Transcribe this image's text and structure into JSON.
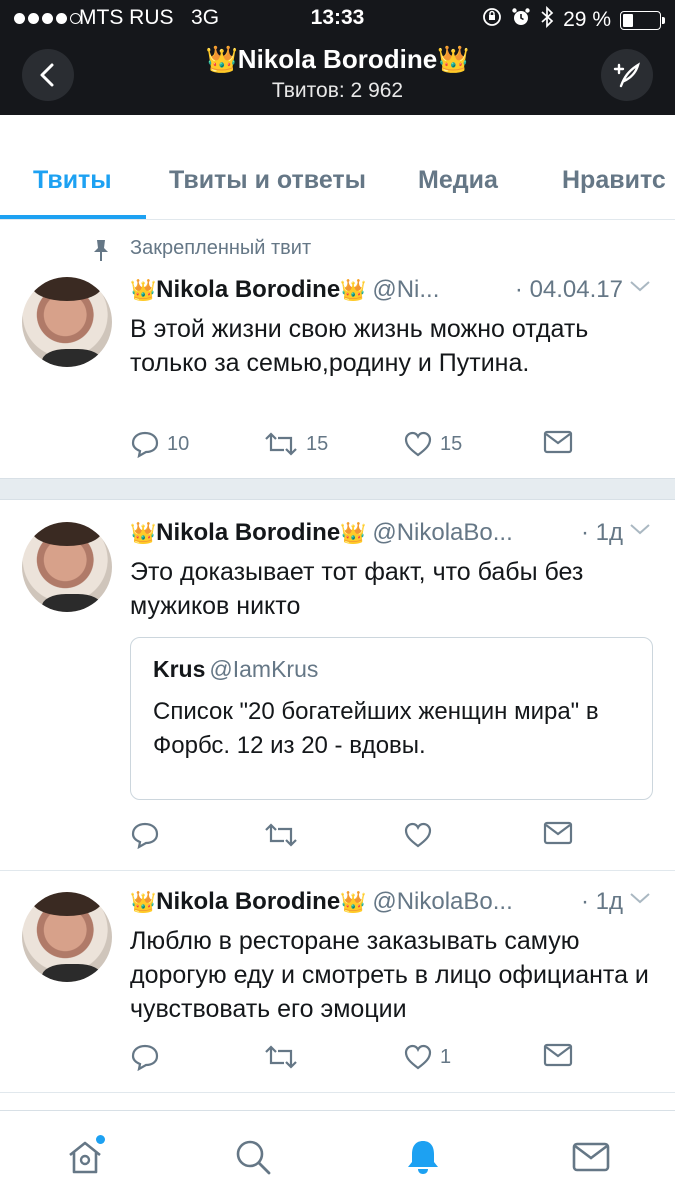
{
  "status_bar": {
    "carrier": "MTS RUS",
    "network": "3G",
    "time": "13:33",
    "battery": "29 %",
    "battery_level": 0.29,
    "signal_bars": 4
  },
  "header": {
    "title": "👑Nikola Borodine👑",
    "subtitle": "Твитов: 2 962"
  },
  "tabs": [
    {
      "label": "Твиты",
      "active": true
    },
    {
      "label": "Твиты и ответы",
      "active": false
    },
    {
      "label": "Медиа",
      "active": false
    },
    {
      "label": "Нравитс",
      "active": false
    }
  ],
  "tweets": [
    {
      "pinned_label": "Закрепленный твит",
      "crown": "👑",
      "name": "Nikola Borodine",
      "handle": "@Ni...",
      "date": "· 04.04.17",
      "text": "В этой жизни свою жизнь можно отдать только за семью,родину и Путина.",
      "replies": "10",
      "retweets": "15",
      "likes": "15"
    },
    {
      "crown": "👑",
      "name": "Nikola Borodine",
      "handle": "@NikolaBo...",
      "date": "· 1д",
      "text": "Это доказывает тот факт, что бабы без мужиков никто",
      "quote": {
        "name": "Krus",
        "handle": "@IamKrus",
        "text": "Список \"20 богатейших женщин мира\" в Форбс. 12 из 20 - вдовы."
      },
      "replies": "",
      "retweets": "",
      "likes": ""
    },
    {
      "crown": "👑",
      "name": "Nikola Borodine",
      "handle": "@NikolaBo...",
      "date": "· 1д",
      "text": "Люблю в ресторане заказывать самую дорогую еду и смотреть в лицо официанта и чувствовать его эмоции",
      "replies": "",
      "retweets": "",
      "likes": "1"
    }
  ],
  "bottom_nav": [
    {
      "icon": "home-icon",
      "active": false,
      "has_badge": true
    },
    {
      "icon": "search-icon",
      "active": false
    },
    {
      "icon": "notifications-icon",
      "active": true
    },
    {
      "icon": "messages-icon",
      "active": false
    }
  ],
  "colors": {
    "accent": "#1da1f2",
    "header_bg": "#15171b",
    "muted": "#657786"
  }
}
